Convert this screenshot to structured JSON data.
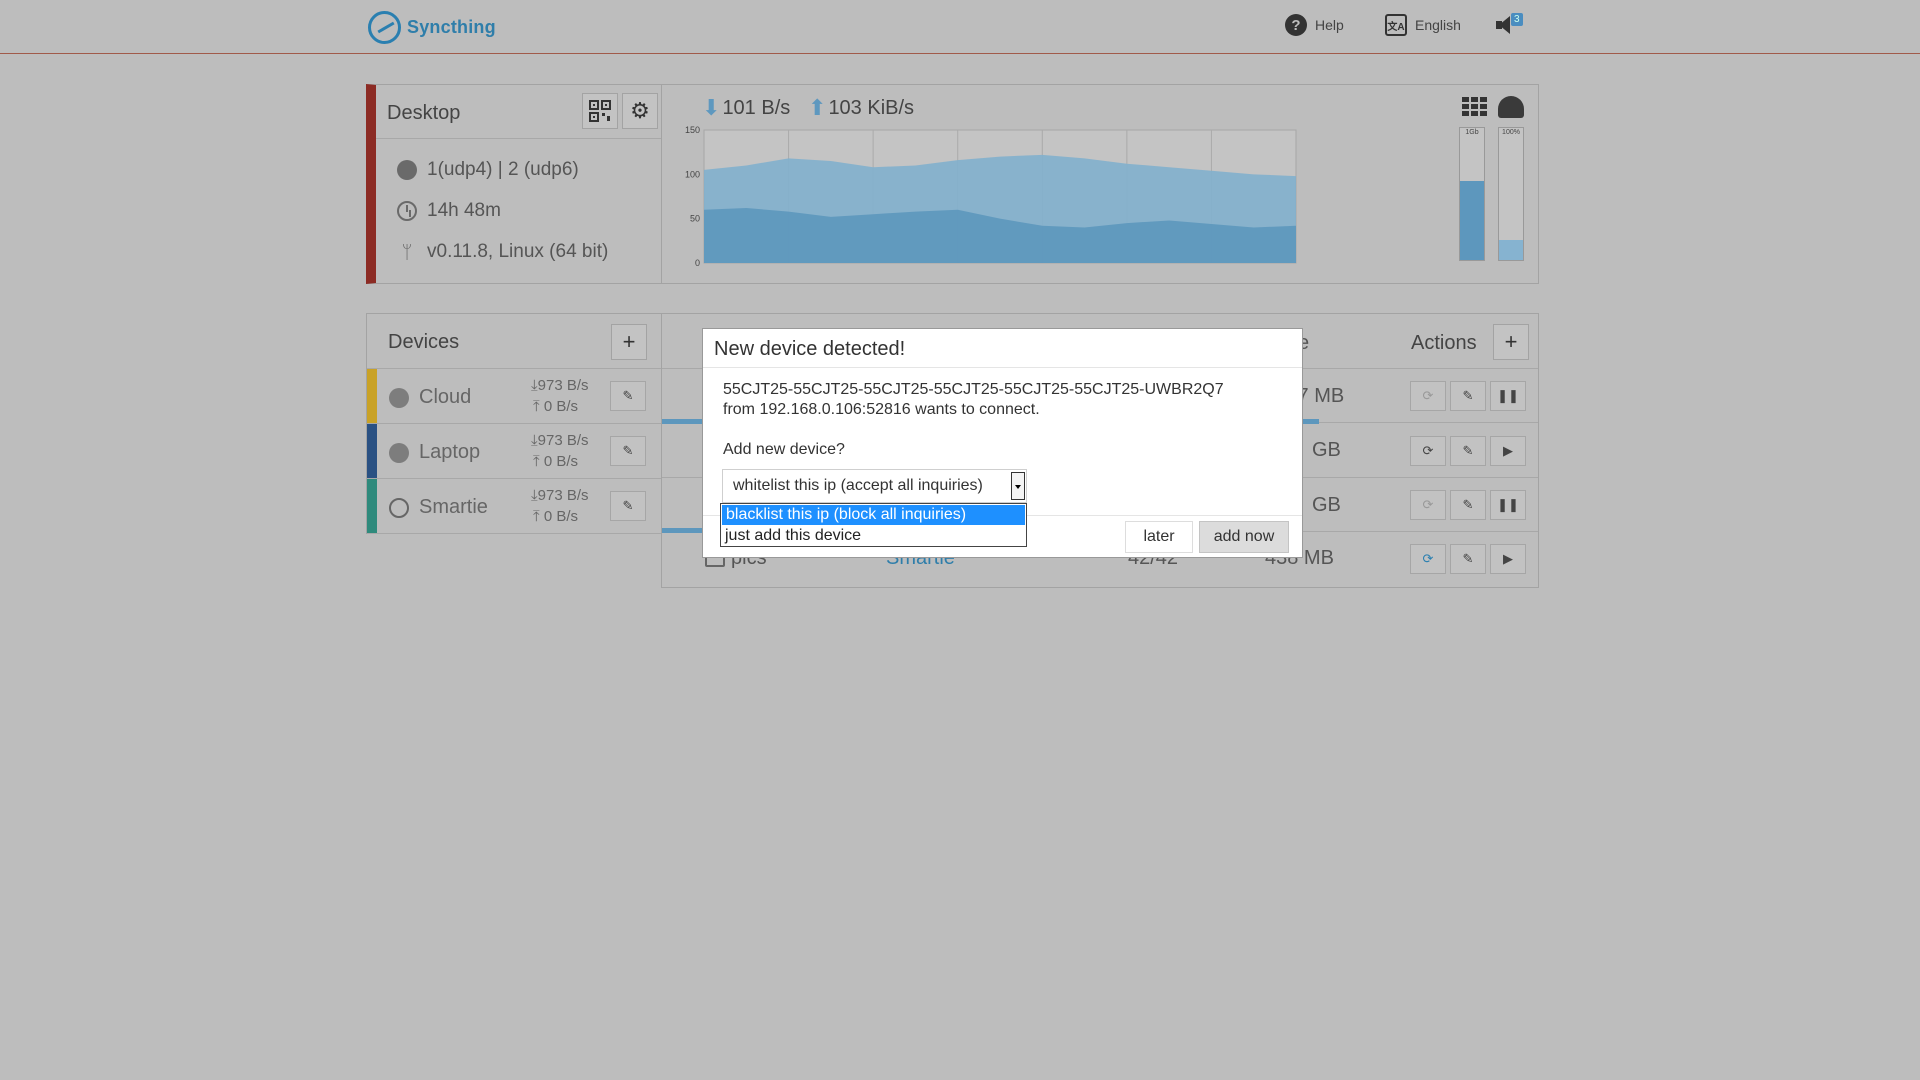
{
  "header": {
    "brand": "Syncthing",
    "help": "Help",
    "language": "English",
    "notification_count": "3"
  },
  "this_device": {
    "name": "Desktop",
    "listeners": "1(udp4) | 2 (udp6)",
    "uptime": "14h 48m",
    "version": "v0.11.8, Linux (64 bit)"
  },
  "traffic": {
    "download_rate": "101 B/s",
    "upload_rate": "103 KiB/s",
    "mem_label": "1Gb",
    "cpu_label": "100%",
    "mem_fraction": 0.6,
    "cpu_fraction": 0.15
  },
  "chart_data": {
    "type": "area",
    "ylim": [
      0,
      150
    ],
    "yticks": [
      "150",
      "100",
      "50",
      "0"
    ],
    "x": [
      0,
      1,
      2,
      3,
      4,
      5,
      6,
      7,
      8,
      9,
      10,
      11,
      12,
      13,
      14
    ],
    "series": [
      {
        "values": [
          105,
          110,
          118,
          115,
          108,
          110,
          116,
          120,
          122,
          118,
          112,
          108,
          104,
          100,
          98
        ]
      },
      {
        "values": [
          60,
          62,
          58,
          52,
          55,
          58,
          60,
          50,
          42,
          40,
          45,
          48,
          44,
          40,
          42
        ]
      }
    ]
  },
  "devices": {
    "title": "Devices",
    "items": [
      {
        "name": "Cloud",
        "down": "973 B/s",
        "up": "0 B/s",
        "color": "#c9a227"
      },
      {
        "name": "Laptop",
        "down": "973 B/s",
        "up": "0 B/s",
        "color": "#2a5183"
      },
      {
        "name": "Smartie",
        "down": "973 B/s",
        "up": "0 B/s",
        "color": "#2e8a7c"
      }
    ]
  },
  "folders": {
    "actions_header": "Actions",
    "header_partial": "e",
    "rows": [
      {
        "size": ".7 MB",
        "progress": 0.75
      },
      {
        "size": "GB"
      },
      {
        "size": "GB",
        "progress": 0.06
      },
      {
        "name": "pics",
        "device": "Smartie",
        "files": "42/42",
        "size": "438 MB"
      }
    ]
  },
  "modal": {
    "title": "New device detected!",
    "device_id": "55CJT25-55CJT25-55CJT25-55CJT25-55CJT25-55CJT25-UWBR2Q7",
    "from_line": "from 192.168.0.106:52816 wants to connect.",
    "question": "Add new device?",
    "select_value": "whitelist this ip (accept all inquiries)",
    "options": [
      "blacklist this ip (block all inquiries)",
      "just add this device"
    ],
    "later_label": "later",
    "add_label": "add now"
  }
}
